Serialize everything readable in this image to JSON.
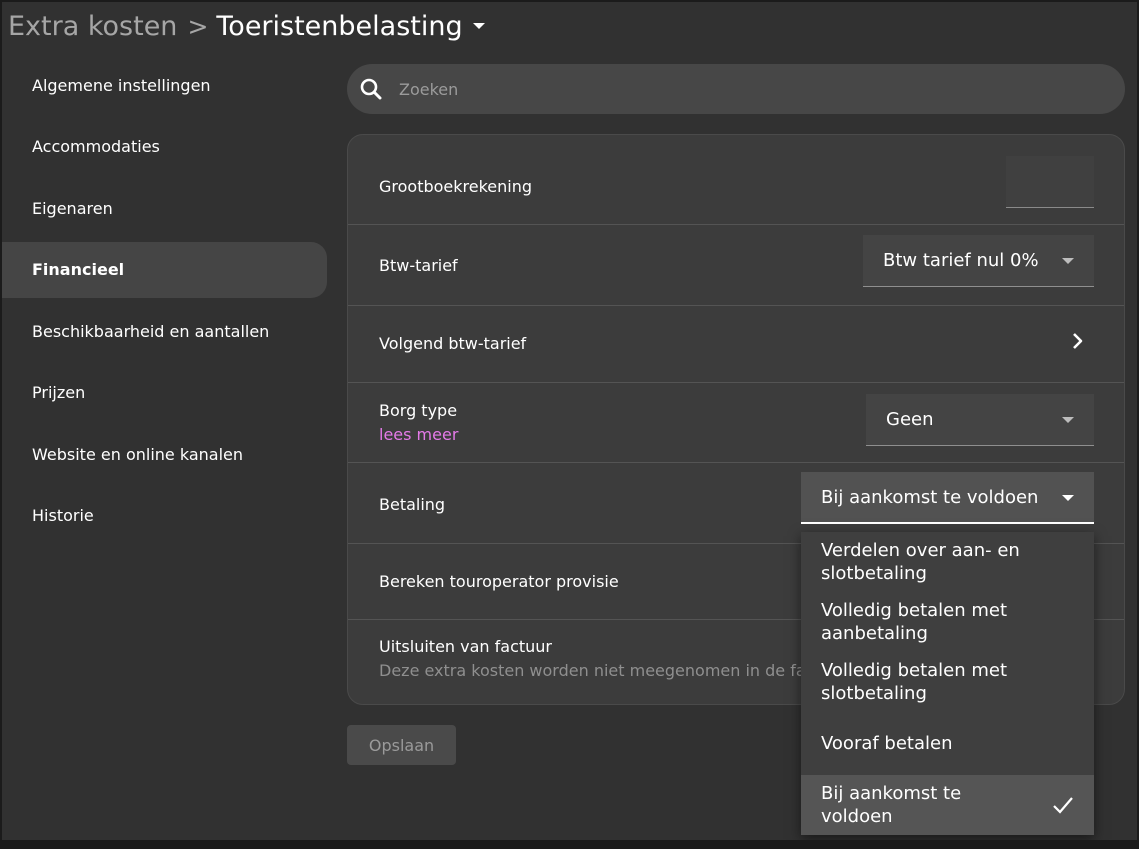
{
  "breadcrumb": {
    "parent": "Extra kosten",
    "separator": ">",
    "current": "Toeristenbelasting"
  },
  "sidebar": {
    "items": [
      {
        "label": "Algemene instellingen"
      },
      {
        "label": "Accommodaties"
      },
      {
        "label": "Eigenaren"
      },
      {
        "label": "Financieel",
        "active": true
      },
      {
        "label": "Beschikbaarheid en aantallen"
      },
      {
        "label": "Prijzen"
      },
      {
        "label": "Website en online kanalen"
      },
      {
        "label": "Historie"
      }
    ]
  },
  "search": {
    "placeholder": "Zoeken",
    "icon": "search-icon"
  },
  "form": {
    "grootboek": {
      "label": "Grootboekrekening",
      "value": ""
    },
    "btw": {
      "label": "Btw-tarief",
      "value": "Btw tarief nul 0%"
    },
    "volgend_btw": {
      "label": "Volgend btw-tarief",
      "icon": "chevron-right-icon"
    },
    "borg": {
      "label": "Borg type",
      "link": "lees meer",
      "value": "Geen"
    },
    "betaling": {
      "label": "Betaling",
      "value": "Bij aankomst te voldoen"
    },
    "touroperator": {
      "label": "Bereken touroperator provisie"
    },
    "uitsluiten": {
      "label": "Uitsluiten van factuur",
      "description": "Deze extra kosten worden niet meegenomen in de factuur"
    }
  },
  "save_button": {
    "label": "Opslaan"
  },
  "betaling_menu": {
    "options": [
      {
        "label": "Verdelen over aan- en slotbetaling"
      },
      {
        "label": "Volledig betalen met aanbetaling"
      },
      {
        "label": "Volledig betalen met slotbetaling"
      },
      {
        "label": "Vooraf betalen"
      },
      {
        "label": "Bij aankomst te voldoen",
        "selected": true,
        "icon": "check-icon"
      }
    ]
  },
  "colors": {
    "background": "#313131",
    "card": "#3c3c3c",
    "link": "#e57ae9",
    "active_sidebar": "#454545",
    "menu_selected": "#555555"
  }
}
